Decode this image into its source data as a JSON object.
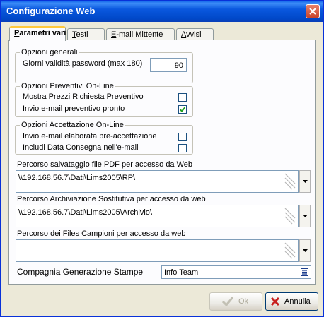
{
  "window": {
    "title": "Configurazione Web"
  },
  "tabs": [
    {
      "label": "Parametri vari",
      "accel": "P",
      "rest": "arametri vari"
    },
    {
      "label": "Testi",
      "accel": "T",
      "rest": "esti"
    },
    {
      "label": "E-mail Mittente",
      "accel": "E",
      "rest": "-mail Mittente"
    },
    {
      "label": "Avvisi",
      "accel": "A",
      "rest": "vvisi"
    }
  ],
  "opzioni_generali": {
    "title": "Opzioni generali",
    "password_label": "Giorni validità password (max 180)",
    "password_value": "90"
  },
  "opzioni_preventivi": {
    "title": "Opzioni Preventivi On-Line",
    "mostra_prezzi_label": "Mostra Prezzi Richiesta Preventivo",
    "mostra_prezzi_checked": false,
    "invio_email_label": "Invio e-mail preventivo pronto",
    "invio_email_checked": true
  },
  "opzioni_accettazione": {
    "title": "Opzioni Accettazione On-Line",
    "invio_email_label": "Invio e-mail elaborata pre-accettazione",
    "invio_email_checked": false,
    "includi_data_label": "Includi Data Consegna nell'e-mail",
    "includi_data_checked": false
  },
  "percorso_pdf": {
    "label": "Percorso salvataggio file PDF per accesso da Web",
    "value": "\\\\192.168.56.7\\Dati\\Lims2005\\RP\\"
  },
  "percorso_archiviazione": {
    "label": "Percorso Archiviazione Sostitutiva per accesso da web",
    "value": "\\\\192.168.56.7\\Dati\\Lims2005\\Archivio\\"
  },
  "percorso_campioni": {
    "label": "Percorso dei Files Campioni per accesso da web",
    "value": ""
  },
  "compagnia": {
    "label": "Compagnia Generazione Stampe",
    "value": "Info Team"
  },
  "buttons": {
    "ok": "Ok",
    "annulla": "Annulla"
  }
}
